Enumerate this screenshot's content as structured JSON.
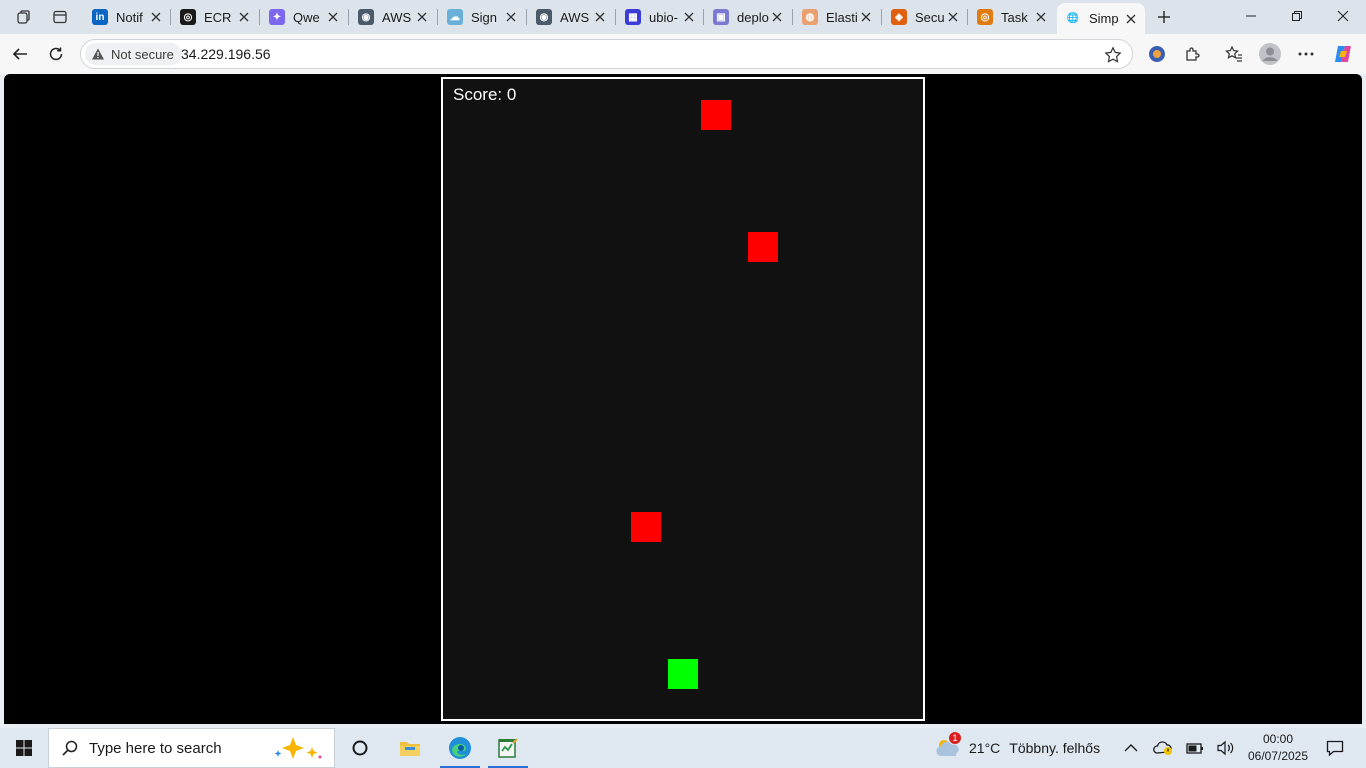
{
  "browser": {
    "tabs": [
      {
        "title": "Notif",
        "icon": "linkedin-icon",
        "color": "#0a66c2",
        "glyph": "in"
      },
      {
        "title": "ECR I",
        "icon": "openai-icon",
        "color": "#1a1a1a",
        "glyph": "◎"
      },
      {
        "title": "Qwe",
        "icon": "qwen-icon",
        "color": "#7b68ee",
        "glyph": "✦"
      },
      {
        "title": "AWS",
        "icon": "eye-icon",
        "color": "#4a5a6a",
        "glyph": "◉"
      },
      {
        "title": "Sign",
        "icon": "cloud-icon",
        "color": "#6ab0d8",
        "glyph": "☁"
      },
      {
        "title": "AWS",
        "icon": "eye-icon",
        "color": "#4a5a6a",
        "glyph": "◉"
      },
      {
        "title": "ubio-",
        "icon": "bucket-icon",
        "color": "#3b3bd6",
        "glyph": "▦"
      },
      {
        "title": "deplo",
        "icon": "app-icon",
        "color": "#7a7ad0",
        "glyph": "▣"
      },
      {
        "title": "Elasti",
        "icon": "elastic-icon",
        "color": "#e8a070",
        "glyph": "◍"
      },
      {
        "title": "Secu",
        "icon": "security-icon",
        "color": "#e0600f",
        "glyph": "◈"
      },
      {
        "title": "Task",
        "icon": "task-icon",
        "color": "#e07b10",
        "glyph": "◎"
      },
      {
        "title": "Simp",
        "icon": "globe-icon",
        "color": "#555555",
        "glyph": "🌐",
        "active": true
      }
    ],
    "security_label": "Not secure",
    "url": "34.229.196.56"
  },
  "game": {
    "score_label": "Score: 0",
    "canvas_color": "#111111",
    "border_color": "#ffffff",
    "enemy_color": "#ff0000",
    "player_color": "#00ff00"
  },
  "taskbar": {
    "search_placeholder": "Type here to search",
    "weather_temp": "21°C",
    "weather_text": "Többny. felhős",
    "weather_badge": "1",
    "time": "00:00",
    "date": "06/07/2025"
  }
}
